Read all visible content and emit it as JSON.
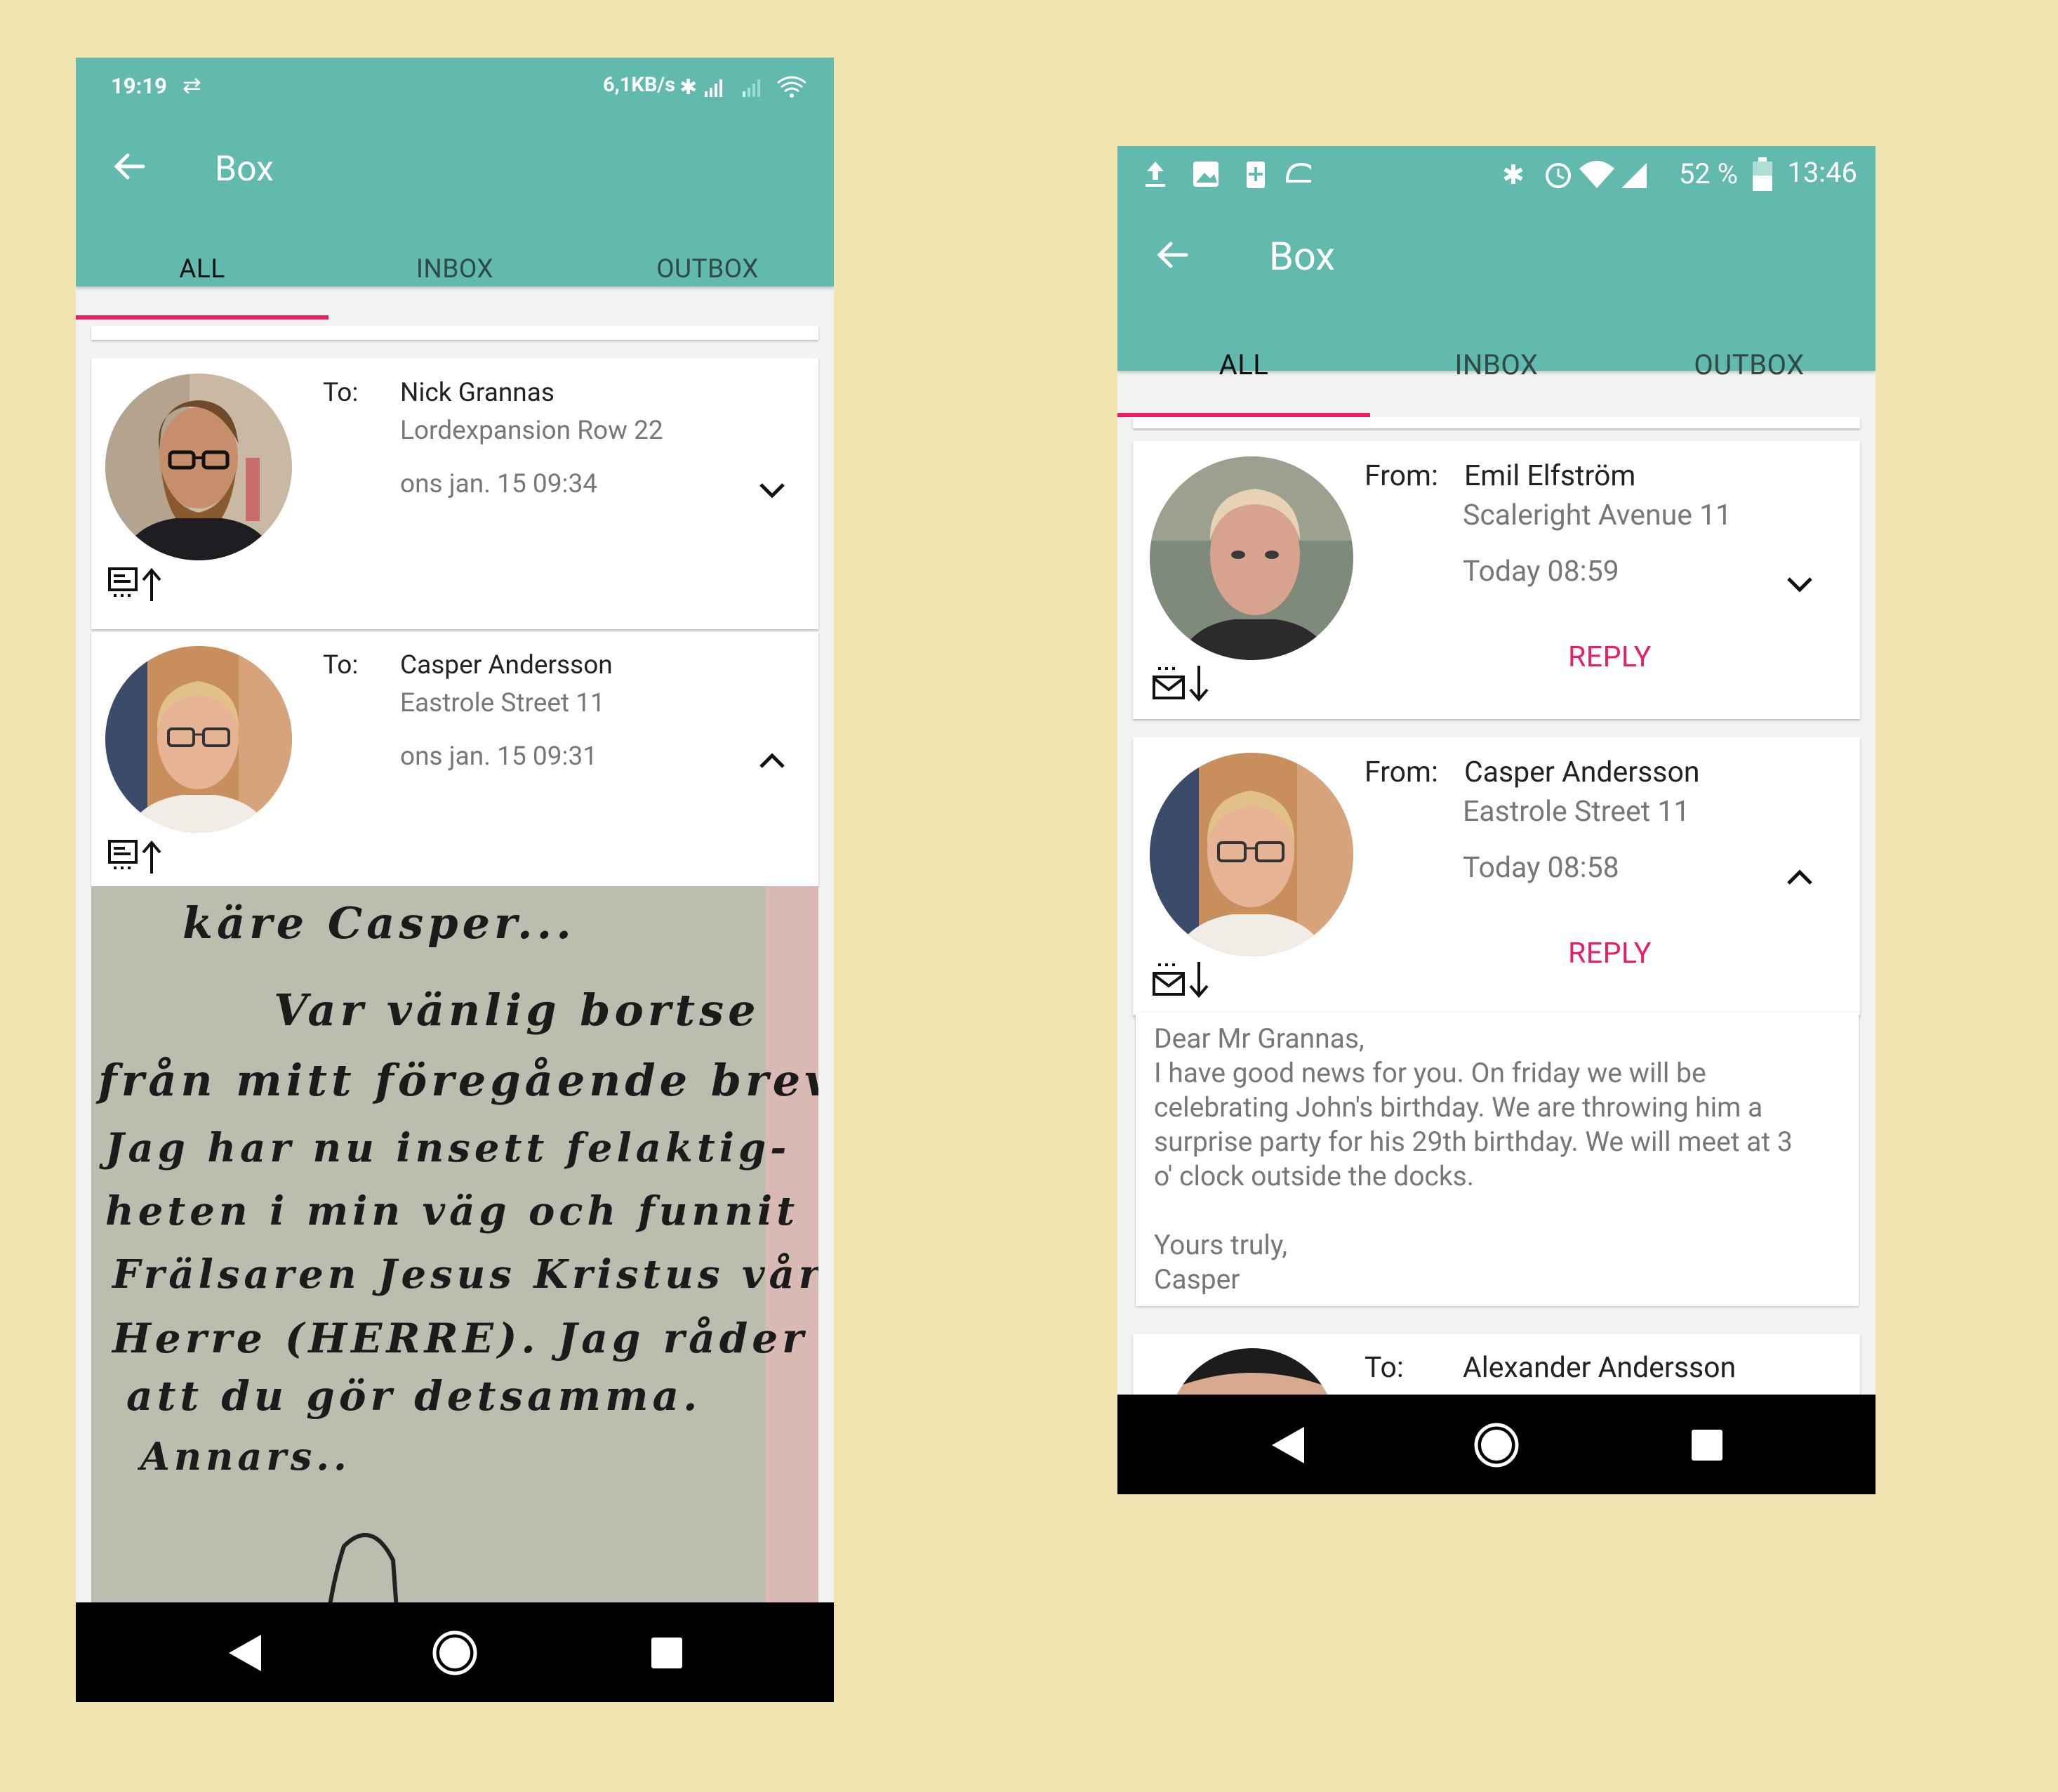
{
  "colors": {
    "background": "#F0E4B0",
    "primary": "#61BAAD",
    "accent": "#E91E63"
  },
  "left_screen": {
    "status": {
      "time": "19:19",
      "network_rate": "6,1KB/s"
    },
    "appbar": {
      "title": "Box"
    },
    "tabs": [
      "ALL",
      "INBOX",
      "OUTBOX"
    ],
    "messages": [
      {
        "direction": "To:",
        "name": "Nick Grannas",
        "address": "Lordexpansion Row 22",
        "date": "ons jan. 15 09:34",
        "type_icon": "sent-letter-icon",
        "state": "collapsed"
      },
      {
        "direction": "To:",
        "name": "Casper Andersson",
        "address": "Eastrole Street 11",
        "date": "ons jan. 15 09:31",
        "type_icon": "sent-letter-icon",
        "state": "expanded"
      }
    ],
    "letter_lines": [
      "käre Casper...",
      "Var vänlig bortse",
      "från mitt föregående brev.",
      "Jag har nu insett felaktig-",
      "heten i min väg och funnit",
      "Frälsaren Jesus Kristus vår",
      "Herre (HERRE). Jag råder",
      "att du gör detsamma.",
      "Annars.."
    ]
  },
  "right_screen": {
    "status": {
      "battery": "52 %",
      "time": "13:46"
    },
    "appbar": {
      "title": "Box"
    },
    "tabs": [
      "ALL",
      "INBOX",
      "OUTBOX"
    ],
    "messages": [
      {
        "direction": "From:",
        "name": "Emil Elfström",
        "address": "Scaleright Avenue 11",
        "date": "Today 08:59",
        "reply": "REPLY",
        "type_icon": "received-mail-icon",
        "state": "collapsed"
      },
      {
        "direction": "From:",
        "name": "Casper Andersson",
        "address": "Eastrole Street 11",
        "date": "Today 08:58",
        "reply": "REPLY",
        "type_icon": "received-mail-icon",
        "state": "expanded"
      },
      {
        "direction": "To:",
        "name": "Alexander Andersson"
      }
    ],
    "message_body": [
      "Dear Mr Grannas,",
      "I have good news for you. On friday we will be",
      "celebrating John's birthday. We are throwing him a",
      "surprise party for his 29th birthday. We will meet at 3",
      "o' clock outside the docks.",
      "",
      "Yours truly,",
      "Casper"
    ]
  }
}
